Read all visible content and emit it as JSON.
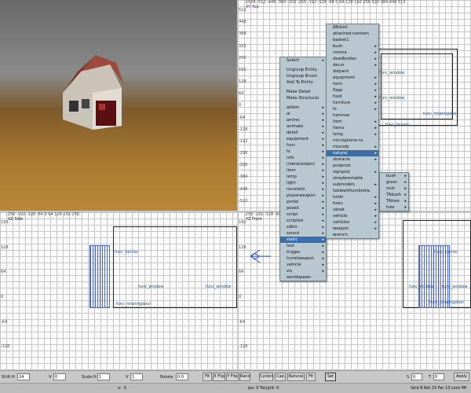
{
  "viewports": {
    "xy_label": "XY Top",
    "xz_label": "XZ Side",
    "yz_label": "YZ Front"
  },
  "rulers": {
    "xy_top": "-1024 -512 -448 -384 -320 -256 -192 -128 -64 0 64 128 192 256 320 384 448 512",
    "xz_top": "-256 -192 -128 -64 0 64 128 192 256",
    "yz_top": "-256 -192 -128 -64 0 64 128 192 256",
    "xy_left": [
      "512",
      "448",
      "384",
      "320",
      "256",
      "192",
      "128",
      "64",
      "0",
      "-64",
      "-128",
      "-192",
      "-256",
      "-320",
      "-384",
      "-448",
      "-512"
    ],
    "xz_left": [
      "192",
      "128",
      "64",
      "0",
      "-64",
      "-128"
    ],
    "yz_left": [
      "192",
      "128",
      "64",
      "0",
      "-64",
      "-128"
    ]
  },
  "entities": {
    "xy": [
      "func_window",
      "func_window",
      "func_rotatingdoor",
      "func_barrier"
    ],
    "xz": [
      "func_barrier",
      "func_window",
      "func_window",
      "func_rotatingdoor"
    ],
    "yz": [
      "func_barrier",
      "func_window",
      "func_window",
      "func_rotatingdoor"
    ]
  },
  "menus": {
    "main": [
      {
        "label": "Select",
        "sub": true
      },
      {
        "sep": true
      },
      {
        "label": "Ungroup Entity"
      },
      {
        "label": "Ungroup Brush"
      },
      {
        "label": "Add To Entity"
      },
      {
        "sep": true
      },
      {
        "label": "Make Detail"
      },
      {
        "label": "Make Structural"
      },
      {
        "sep": true
      },
      {
        "label": "addon",
        "sub": true
      },
      {
        "label": "ai",
        "sub": true
      },
      {
        "label": "ammo",
        "sub": true
      },
      {
        "label": "animate",
        "sub": true
      },
      {
        "label": "detail",
        "sub": true
      },
      {
        "label": "equipment",
        "sub": true
      },
      {
        "label": "func",
        "sub": true
      },
      {
        "label": "fx",
        "sub": true
      },
      {
        "label": "info",
        "sub": true
      },
      {
        "label": "interactobject",
        "sub": true
      },
      {
        "label": "item",
        "sub": true
      },
      {
        "label": "lamp",
        "sub": true
      },
      {
        "label": "light",
        "sub": true
      },
      {
        "label": "nonstatic",
        "sub": true
      },
      {
        "label": "playerweapon",
        "sub": true
      },
      {
        "label": "portal",
        "sub": true
      },
      {
        "label": "posed",
        "sub": true
      },
      {
        "label": "script",
        "sub": true
      },
      {
        "label": "scripted",
        "sub": true
      },
      {
        "label": "sdkfz",
        "sub": true
      },
      {
        "label": "sound",
        "sub": true
      },
      {
        "label": "static",
        "sub": true,
        "hl": true
      },
      {
        "label": "test",
        "sub": true
      },
      {
        "label": "trigger",
        "sub": true
      },
      {
        "label": "turretweapon",
        "sub": true
      },
      {
        "label": "vehicle",
        "sub": true
      },
      {
        "label": "vis",
        "sub": true
      },
      {
        "label": "worldspawn"
      }
    ],
    "static": [
      {
        "label": "88shell"
      },
      {
        "label": "attached-canteen"
      },
      {
        "label": "basket1"
      },
      {
        "label": "bush",
        "sub": true
      },
      {
        "label": "corona",
        "sub": true
      },
      {
        "label": "deadbodies",
        "sub": true
      },
      {
        "label": "decor",
        "sub": true
      },
      {
        "label": "dstpack"
      },
      {
        "label": "equipment",
        "sub": true
      },
      {
        "label": "farm",
        "sub": true
      },
      {
        "label": "flags",
        "sub": true
      },
      {
        "label": "food",
        "sub": true
      },
      {
        "label": "furniture",
        "sub": true
      },
      {
        "label": "fx",
        "sub": true
      },
      {
        "label": "hammer"
      },
      {
        "label": "item",
        "sub": true
      },
      {
        "label": "items",
        "sub": true
      },
      {
        "label": "lamp",
        "sub": true
      },
      {
        "label": "microphone-ns"
      },
      {
        "label": "mixcobj",
        "sub": true
      },
      {
        "label": "natural",
        "sub": true,
        "hl": true
      },
      {
        "label": "obstacle",
        "sub": true
      },
      {
        "label": "projector"
      },
      {
        "label": "signpost",
        "sub": true
      },
      {
        "label": "simplerectable"
      },
      {
        "label": "submodels",
        "sub": true
      },
      {
        "label": "tablewithumbrella"
      },
      {
        "label": "toilet",
        "sub": true
      },
      {
        "label": "town",
        "sub": true
      },
      {
        "label": "uboat",
        "sub": true
      },
      {
        "label": "vehicle",
        "sub": true
      },
      {
        "label": "vehicles",
        "sub": true
      },
      {
        "label": "weapon",
        "sub": true
      },
      {
        "label": "wrench"
      }
    ],
    "natural": [
      {
        "label": "bush",
        "sub": true
      },
      {
        "label": "grass",
        "sub": true
      },
      {
        "label": "rock",
        "sub": true
      },
      {
        "label": "TAbush",
        "sub": true
      },
      {
        "label": "TAtree",
        "sub": true
      },
      {
        "label": "tree",
        "sub": true
      }
    ]
  },
  "toolbar": {
    "shift_h_label": "Shift H",
    "shift_h": "24",
    "v1_label": "V",
    "v1": "0",
    "scale_h_label": "Scale H",
    "scale_h": "1",
    "v2_label": "V",
    "v2": "1",
    "rotate_label": "Rotate",
    "rotate": "0.0",
    "fit": "Fit",
    "xflip": "X Flip",
    "yflip": "Y Flip",
    "rand": "Rand",
    "cycle": "Cycle>",
    "cap": "Cap",
    "natural": "Natural",
    "fit2": "Fit",
    "set": "Set",
    "s_label": "S",
    "s_val": "0",
    "t_label": "T",
    "t_val": "0",
    "apply": "Apply"
  },
  "status": {
    "left": "x: -5",
    "mid": "jes: 0 ToLight: 0",
    "right": "Grid 8 Rot 15 Far 13 Lock Mf"
  }
}
